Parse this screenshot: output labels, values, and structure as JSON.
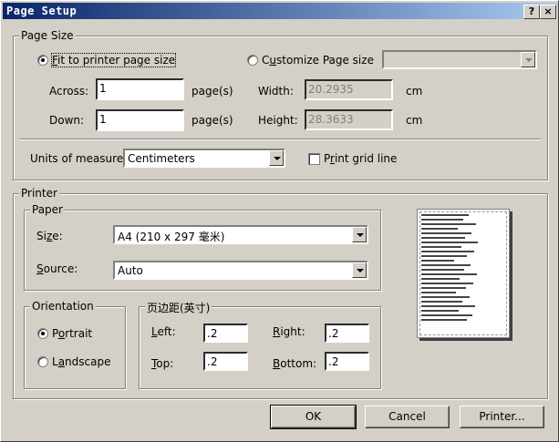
{
  "window": {
    "title": "Page Setup",
    "help_glyph": "?",
    "close_glyph": "×"
  },
  "page_size": {
    "legend": "Page Size",
    "fit_label_pre": "",
    "fit_label_u": "F",
    "fit_label_post": "it to printer page size",
    "custom_label_pre": "C",
    "custom_label_u": "u",
    "custom_label_post": "stomize Page size",
    "custom_select_value": "",
    "across_label": "Across:",
    "across_value": "1",
    "across_unit": "page(s)",
    "down_label": "Down:",
    "down_value": "1",
    "down_unit": "page(s)",
    "width_label": "Width:",
    "width_value": "20.2935",
    "width_unit": "cm",
    "height_label": "Height:",
    "height_value": "28.3633",
    "height_unit": "cm",
    "fit_selected": true
  },
  "units": {
    "label": "Units of measure:",
    "value": "Centimeters",
    "grid_label_pre": "P",
    "grid_label_u": "r",
    "grid_label_post": "int grid line",
    "grid_checked": false
  },
  "printer": {
    "legend": "Printer",
    "paper": {
      "legend": "Paper",
      "size_label_pre": "Si",
      "size_label_u": "z",
      "size_label_post": "e:",
      "size_value": "A4 (210 x 297 毫米)",
      "source_label_pre": "",
      "source_label_u": "S",
      "source_label_post": "ource:",
      "source_value": "Auto"
    },
    "orientation": {
      "legend": "Orientation",
      "portrait_pre": "P",
      "portrait_u": "o",
      "portrait_post": "rtrait",
      "landscape_pre": "L",
      "landscape_u": "a",
      "landscape_post": "ndscape",
      "selected": "portrait"
    },
    "margins": {
      "legend": "页边距(英寸)",
      "left_label_pre": "",
      "left_label_u": "L",
      "left_label_post": "eft:",
      "left_value": ".2",
      "right_label_pre": "",
      "right_label_u": "R",
      "right_label_post": "ight:",
      "right_value": ".2",
      "top_label_pre": "",
      "top_label_u": "T",
      "top_label_post": "op:",
      "top_value": ".2",
      "bottom_label_pre": "",
      "bottom_label_u": "B",
      "bottom_label_post": "ottom:",
      "bottom_value": ".2"
    }
  },
  "buttons": {
    "ok": "OK",
    "cancel": "Cancel",
    "printer": "Printer..."
  },
  "colors": {
    "face": "#d4d0c8",
    "title_start": "#0a246a",
    "title_end": "#a6caf0"
  }
}
